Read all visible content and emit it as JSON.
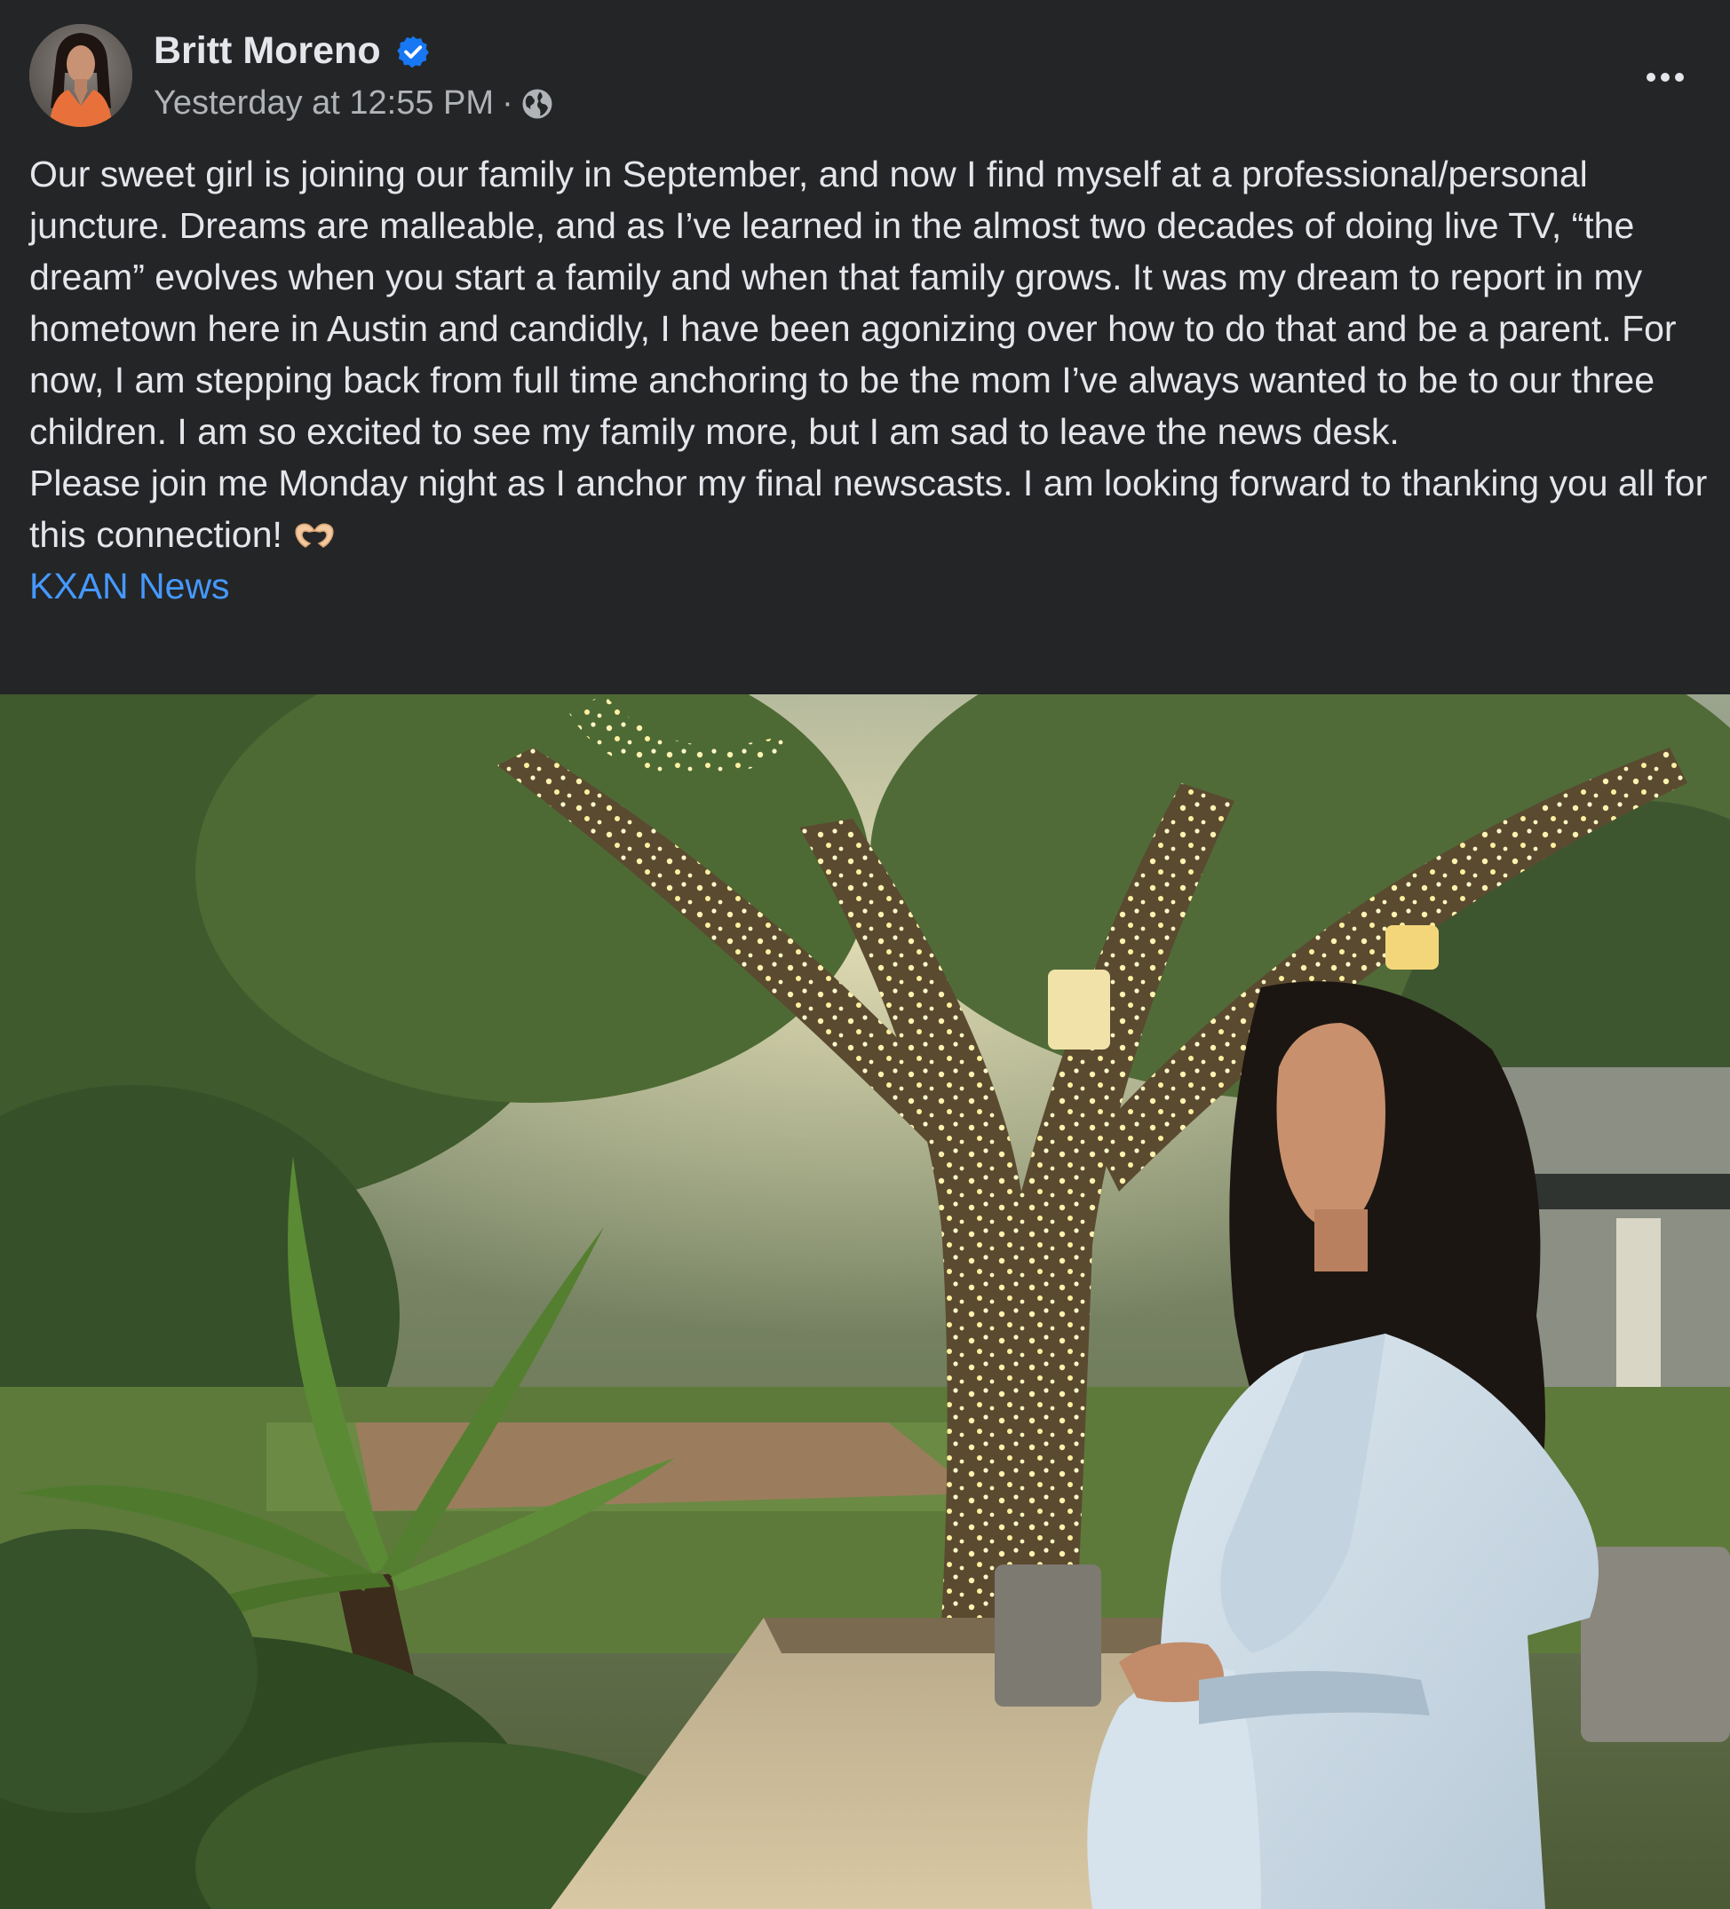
{
  "post": {
    "author": {
      "name": "Britt Moreno",
      "verified": true,
      "avatar_icon": "profile-photo"
    },
    "timestamp": "Yesterday at 12:55 PM",
    "separator": "·",
    "audience_icon": "globe-icon",
    "more_icon": "ellipsis-icon",
    "text": {
      "paragraph1": "Our sweet girl is joining our family in September, and now I find myself at a professional/personal juncture. Dreams are malleable, and as I’ve learned in the almost two decades of doing live TV, “the dream” evolves when you start a family and when that family grows. It was my dream to report in my hometown here in Austin and candidly, I have been agonizing over how to do that and be a parent. For now, I am stepping back from full time anchoring to be the mom I’ve always wanted to be to our three children. I am so excited to see my family more, but I am sad to leave the news desk.",
      "paragraph2": "Please join me Monday night as I anchor my final newscasts. I am looking forward to thanking you all for this connection!",
      "emoji_icon": "heart-hands-icon",
      "tag_link": "KXAN News"
    },
    "colors": {
      "background": "#242526",
      "primary_text": "#e4e6eb",
      "secondary_text": "#b0b3b8",
      "link": "#4599ff",
      "verified_badge": "#1877f2"
    }
  }
}
